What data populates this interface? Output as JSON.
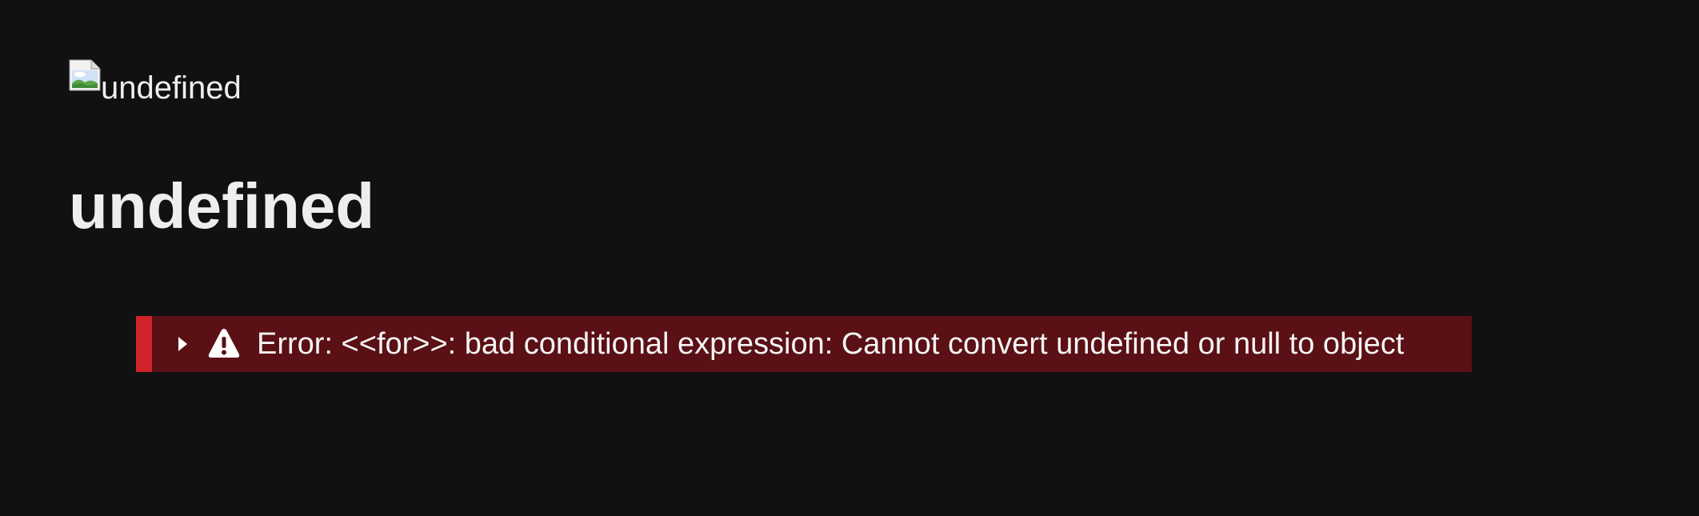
{
  "image": {
    "alt_text": "undefined",
    "icon": "broken-image-icon"
  },
  "page": {
    "title": "undefined"
  },
  "error": {
    "message": "Error: <<for>>: bad conditional expression: Cannot convert undefined or null to object",
    "toggle_icon": "caret-right-icon",
    "status_icon": "warning-icon",
    "colors": {
      "background": "#5a1014",
      "accent_bar": "#d0242c",
      "text": "#f4f4f4"
    }
  },
  "theme": {
    "background": "#111111",
    "text": "#eeeeee"
  }
}
